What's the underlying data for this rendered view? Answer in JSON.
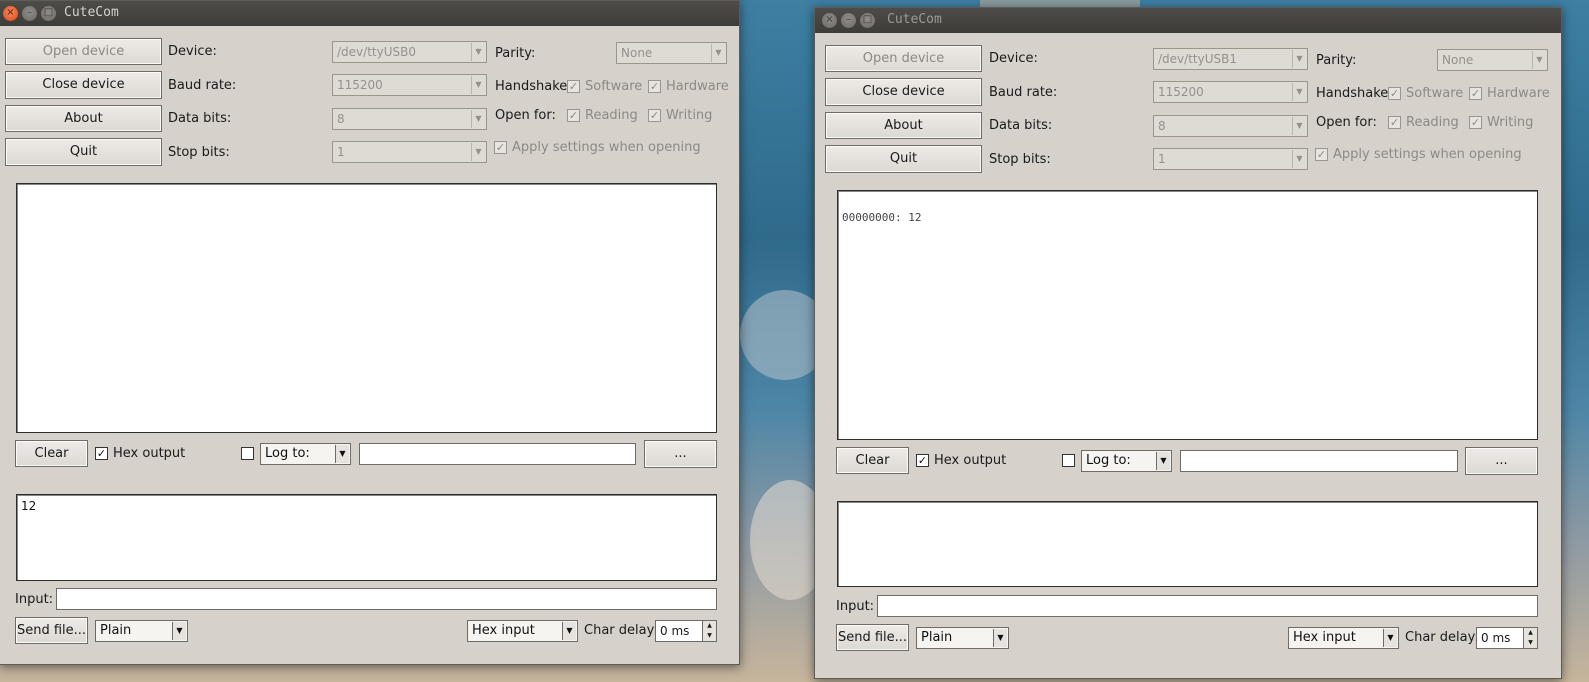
{
  "app_title": "CuteCom",
  "window_controls": {
    "close": "×",
    "minimize": "–",
    "maximize": "□"
  },
  "labels": {
    "device": "Device:",
    "baud_rate": "Baud rate:",
    "data_bits": "Data bits:",
    "stop_bits": "Stop bits:",
    "parity": "Parity:",
    "handshake": "Handshake:",
    "open_for": "Open for:",
    "software": "Software",
    "hardware": "Hardware",
    "reading": "Reading",
    "writing": "Writing",
    "apply_settings": "Apply settings when opening",
    "hex_output": "Hex output",
    "input": "Input:",
    "char_delay": "Char delay:"
  },
  "buttons": {
    "open_device": "Open device",
    "close_device": "Close device",
    "about": "About",
    "quit": "Quit",
    "clear": "Clear",
    "browse": "...",
    "send_file": "Send file..."
  },
  "windows": [
    {
      "device": "/dev/ttyUSB0",
      "baud_rate": "115200",
      "data_bits": "8",
      "stop_bits": "1",
      "parity": "None",
      "hex_output_checked": true,
      "log_to": "Log to:",
      "output_text": "",
      "input_area_text": "12",
      "send_mode": "Plain",
      "input_mode": "Hex input",
      "char_delay": "0 ms"
    },
    {
      "device": "/dev/ttyUSB1",
      "baud_rate": "115200",
      "data_bits": "8",
      "stop_bits": "1",
      "parity": "None",
      "hex_output_checked": true,
      "log_to": "Log to:",
      "output_text": "00000000: 12",
      "input_area_text": "",
      "send_mode": "Plain",
      "input_mode": "Hex input",
      "char_delay": "0 ms"
    }
  ],
  "colors": {
    "window_bg": "#d6d2cb",
    "titlebar_bg": "#3d3c39",
    "close_button": "#dd4814"
  }
}
